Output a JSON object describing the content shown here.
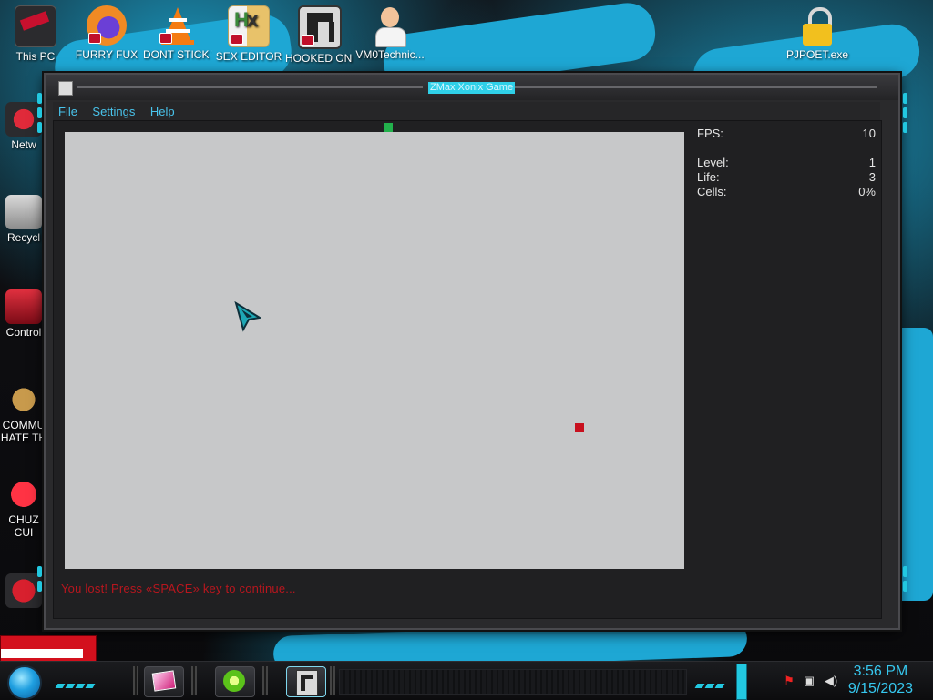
{
  "desktop": {
    "top_icons": [
      {
        "label": "This PC",
        "icon": "computer-icon",
        "color": "#2b2b2e"
      },
      {
        "label": "FURRY FUX",
        "icon": "firefox-icon",
        "color": "#f08a24"
      },
      {
        "label": "DONT STICK THIS IN YO",
        "icon": "vlc-cone-icon",
        "color": "#f47b12"
      },
      {
        "label": "SEX EDITOR",
        "icon": "hxd-editor-icon",
        "color": "#e8c26a"
      },
      {
        "label": "HOOKED ON XONIX",
        "icon": "xonix-game-icon",
        "color": "#d9d9d9"
      },
      {
        "label": "VM0Technic...",
        "icon": "doctor-avatar-icon",
        "color": "#f2c39a"
      },
      {
        "label": "PJPOET.exe",
        "icon": "padlock-icon",
        "color": "#f2c01e"
      }
    ],
    "left_icons": [
      {
        "label": "Netw",
        "icon": "network-icon"
      },
      {
        "label": "Recycl",
        "icon": "recycle-bin-icon"
      },
      {
        "label": "Control",
        "icon": "control-panel-icon"
      },
      {
        "label": "COMMU HATE TH",
        "icon": "money-bag-icon"
      },
      {
        "label": "CHUZ CUI",
        "icon": "red-creature-icon"
      },
      {
        "label": "",
        "icon": "red-app-icon"
      }
    ]
  },
  "window": {
    "title": "ZMax Xonix Game",
    "menu": [
      "File",
      "Settings",
      "Help"
    ],
    "stats": [
      {
        "label": "FPS:",
        "value": "10"
      },
      {
        "label": "Level:",
        "value": "1"
      },
      {
        "label": "Life:",
        "value": "3"
      },
      {
        "label": "Cells:",
        "value": "0%"
      }
    ],
    "status_message": "You lost! Press «SPACE» key to continue...",
    "colors": {
      "playfield": "#c7c8c9",
      "player": "#22b14c",
      "enemy": "#c8101e",
      "menu_text": "#49c4ec",
      "status_text": "#b8161e"
    }
  },
  "taskbar": {
    "apps": [
      {
        "icon": "monitor-app-icon"
      },
      {
        "icon": "lime-app-icon"
      },
      {
        "icon": "xonix-taskbar-icon",
        "active": true
      }
    ],
    "tray": [
      "flag-icon",
      "network-tray-icon",
      "volume-icon"
    ],
    "clock": {
      "time": "3:56 PM",
      "date": "9/15/2023"
    }
  }
}
